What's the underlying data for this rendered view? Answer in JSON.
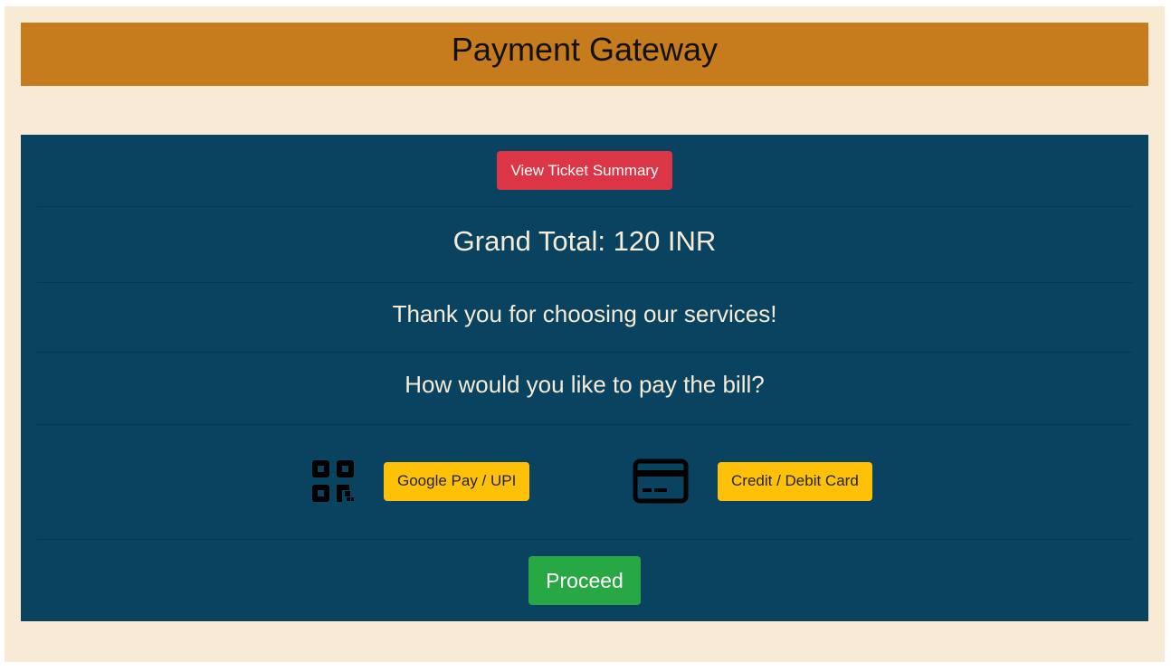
{
  "header": {
    "title": "Payment Gateway"
  },
  "summary": {
    "button_label": "View Ticket Summary"
  },
  "total": {
    "label": "Grand Total:",
    "amount": "120",
    "currency": "INR",
    "text": "Grand Total: 120 INR"
  },
  "messages": {
    "thanks": "Thank you for choosing our services!",
    "question": "How would you like to pay the bill?"
  },
  "payment_options": [
    {
      "icon": "qr-code-icon",
      "label": "Google Pay / UPI"
    },
    {
      "icon": "credit-card-icon",
      "label": "Credit / Debit Card"
    }
  ],
  "actions": {
    "proceed_label": "Proceed"
  },
  "colors": {
    "page_bg": "#f9ead5",
    "header_bg": "#c67b1c",
    "panel_bg": "#0a4360",
    "summary_button": "#dc3545",
    "option_button": "#ffc107",
    "proceed_button": "#28a745",
    "panel_text": "#f6ebd6"
  }
}
